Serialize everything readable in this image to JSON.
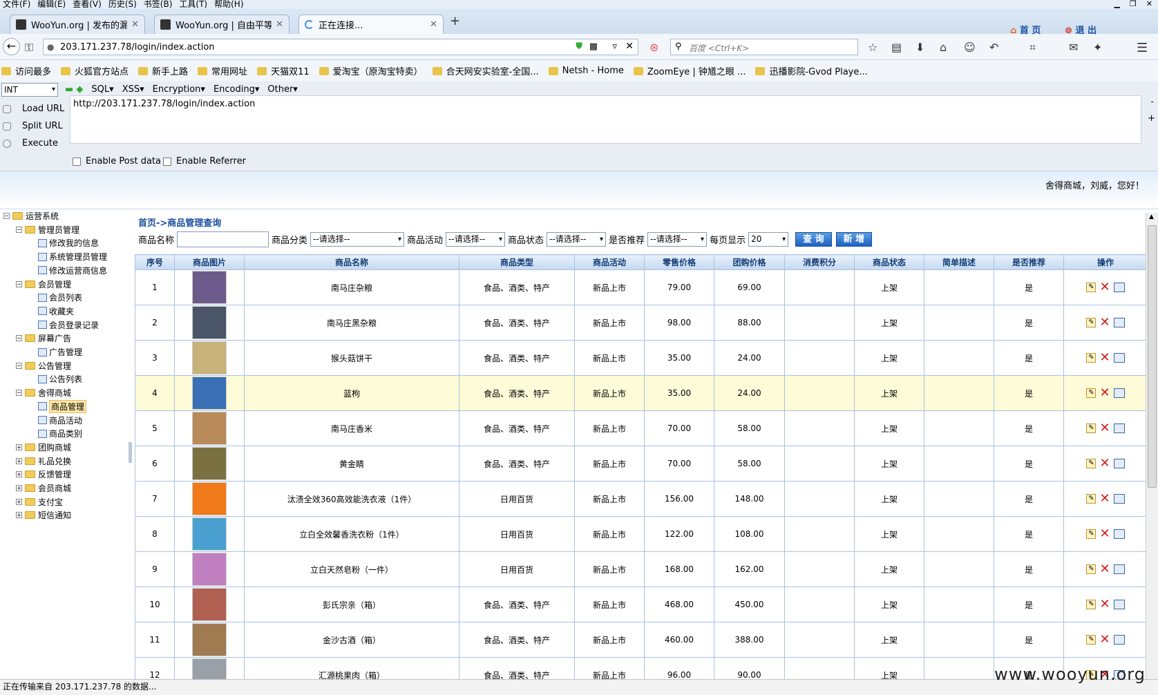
{
  "menubar": [
    "文件(F)",
    "编辑(E)",
    "查看(V)",
    "历史(S)",
    "书签(B)",
    "工具(T)",
    "帮助(H)"
  ],
  "tabs": [
    {
      "title": "WooYun.org | 发布的漏洞"
    },
    {
      "title": "WooYun.org | 自由平等..."
    },
    {
      "title": "正在连接..."
    }
  ],
  "address": {
    "url": "203.171.237.78/login/index.action"
  },
  "search": {
    "placeholder": "百度 <Ctrl+K>"
  },
  "bookmarks": [
    "访问最多",
    "火狐官方站点",
    "新手上路",
    "常用网址",
    "天猫双11",
    "爱淘宝（原淘宝特卖）",
    "合天网安实验室-全国...",
    "Netsh - Home",
    "ZoomEye | 钟馗之眼 ...",
    "迅播影院-Gvod Playe..."
  ],
  "hackbar": {
    "select": "INT",
    "menus": [
      "SQL▾",
      "XSS▾",
      "Encryption▾",
      "Encoding▾",
      "Other▾"
    ],
    "load": "Load URL",
    "split": "Split URL",
    "execute": "Execute",
    "url": "http://203.171.237.78/login/index.action",
    "post": "Enable Post data",
    "referrer": "Enable Referrer"
  },
  "header": {
    "greeting": "舍得商城，刘威，您好！",
    "home": "首 页",
    "logout": "退 出"
  },
  "tree": [
    {
      "label": "运营系统",
      "lvl": 0,
      "t": "fd",
      "pm": "−"
    },
    {
      "label": "管理员管理",
      "lvl": 1,
      "t": "fd",
      "pm": "−"
    },
    {
      "label": "修改我的信息",
      "lvl": 2,
      "t": "pg"
    },
    {
      "label": "系统管理员管理",
      "lvl": 2,
      "t": "pg"
    },
    {
      "label": "修改运营商信息",
      "lvl": 2,
      "t": "pg"
    },
    {
      "label": "会员管理",
      "lvl": 1,
      "t": "fd",
      "pm": "−"
    },
    {
      "label": "会员列表",
      "lvl": 2,
      "t": "pg"
    },
    {
      "label": "收藏夹",
      "lvl": 2,
      "t": "pg"
    },
    {
      "label": "会员登录记录",
      "lvl": 2,
      "t": "pg"
    },
    {
      "label": "屏幕广告",
      "lvl": 1,
      "t": "fd",
      "pm": "−"
    },
    {
      "label": "广告管理",
      "lvl": 2,
      "t": "pg"
    },
    {
      "label": "公告管理",
      "lvl": 1,
      "t": "fd",
      "pm": "−"
    },
    {
      "label": "公告列表",
      "lvl": 2,
      "t": "pg"
    },
    {
      "label": "舍得商城",
      "lvl": 1,
      "t": "fd",
      "pm": "−"
    },
    {
      "label": "商品管理",
      "lvl": 2,
      "t": "pg",
      "sel": true
    },
    {
      "label": "商品活动",
      "lvl": 2,
      "t": "pg"
    },
    {
      "label": "商品类别",
      "lvl": 2,
      "t": "pg"
    },
    {
      "label": "团购商城",
      "lvl": 1,
      "t": "fd",
      "pm": "+"
    },
    {
      "label": "礼品兑换",
      "lvl": 1,
      "t": "fd",
      "pm": "+"
    },
    {
      "label": "反馈管理",
      "lvl": 1,
      "t": "fd",
      "pm": "+"
    },
    {
      "label": "会员商城",
      "lvl": 1,
      "t": "fd",
      "pm": "+"
    },
    {
      "label": "支付宝",
      "lvl": 1,
      "t": "fd",
      "pm": "+"
    },
    {
      "label": "短信通知",
      "lvl": 1,
      "t": "fd",
      "pm": "+"
    }
  ],
  "breadcrumb": "首页->商品管理查询",
  "filters": {
    "name_label": "商品名称",
    "category_label": "商品分类",
    "activity_label": "商品活动",
    "status_label": "商品状态",
    "recommend_label": "是否推荐",
    "pagesize_label": "每页显示",
    "placeholder_select": "--请选择--",
    "pagesize": "20",
    "query": "查 询",
    "add": "新 增"
  },
  "columns": [
    "序号",
    "商品图片",
    "商品名称",
    "商品类型",
    "商品活动",
    "零售价格",
    "团购价格",
    "消费积分",
    "商品状态",
    "简单描述",
    "是否推荐",
    "操作"
  ],
  "rows": [
    {
      "no": "1",
      "name": "南马庄杂粮",
      "type": "食品、酒类、特产",
      "act": "新品上市",
      "retail": "79.00",
      "group": "69.00",
      "points": "",
      "status": "上架",
      "desc": "",
      "rec": "是",
      "img": "#6b5a8a"
    },
    {
      "no": "2",
      "name": "南马庄黑杂粮",
      "type": "食品、酒类、特产",
      "act": "新品上市",
      "retail": "98.00",
      "group": "88.00",
      "points": "",
      "status": "上架",
      "desc": "",
      "rec": "是",
      "img": "#4a5568"
    },
    {
      "no": "3",
      "name": "猴头菇饼干",
      "type": "食品、酒类、特产",
      "act": "新品上市",
      "retail": "35.00",
      "group": "24.00",
      "points": "",
      "status": "上架",
      "desc": "",
      "rec": "是",
      "img": "#c9b27a"
    },
    {
      "no": "4",
      "name": "蓝枸",
      "type": "食品、酒类、特产",
      "act": "新品上市",
      "retail": "35.00",
      "group": "24.00",
      "points": "",
      "status": "上架",
      "desc": "",
      "rec": "是",
      "img": "#3a6fb5"
    },
    {
      "no": "5",
      "name": "南马庄香米",
      "type": "食品、酒类、特产",
      "act": "新品上市",
      "retail": "70.00",
      "group": "58.00",
      "points": "",
      "status": "上架",
      "desc": "",
      "rec": "是",
      "img": "#b98a5a"
    },
    {
      "no": "6",
      "name": "黄金睛",
      "type": "食品、酒类、特产",
      "act": "新品上市",
      "retail": "70.00",
      "group": "58.00",
      "points": "",
      "status": "上架",
      "desc": "",
      "rec": "是",
      "img": "#7a7040"
    },
    {
      "no": "7",
      "name": "汰渍全效360高效能洗衣液（1件）",
      "type": "日用百货",
      "act": "新品上市",
      "retail": "156.00",
      "group": "148.00",
      "points": "",
      "status": "上架",
      "desc": "",
      "rec": "是",
      "img": "#f07a1a"
    },
    {
      "no": "8",
      "name": "立白全效馨香洗衣粉（1件）",
      "type": "日用百货",
      "act": "新品上市",
      "retail": "122.00",
      "group": "108.00",
      "points": "",
      "status": "上架",
      "desc": "",
      "rec": "是",
      "img": "#4aa0d0"
    },
    {
      "no": "9",
      "name": "立白天然皂粉（一件）",
      "type": "日用百货",
      "act": "新品上市",
      "retail": "168.00",
      "group": "162.00",
      "points": "",
      "status": "上架",
      "desc": "",
      "rec": "是",
      "img": "#c080c0"
    },
    {
      "no": "10",
      "name": "彭氏宗亲（箱）",
      "type": "食品、酒类、特产",
      "act": "新品上市",
      "retail": "468.00",
      "group": "450.00",
      "points": "",
      "status": "上架",
      "desc": "",
      "rec": "是",
      "img": "#b06050"
    },
    {
      "no": "11",
      "name": "金沙古酒（箱）",
      "type": "食品、酒类、特产",
      "act": "新品上市",
      "retail": "460.00",
      "group": "388.00",
      "points": "",
      "status": "上架",
      "desc": "",
      "rec": "是",
      "img": "#a07a50"
    },
    {
      "no": "12",
      "name": "汇源桃果肉（箱）",
      "type": "食品、酒类、特产",
      "act": "新品上市",
      "retail": "96.00",
      "group": "90.00",
      "points": "",
      "status": "上架",
      "desc": "",
      "rec": "是",
      "img": "#9aa0a8"
    }
  ],
  "status": "正在传输来自 203.171.237.78 的数据...",
  "watermark": "www.wooyun.org"
}
